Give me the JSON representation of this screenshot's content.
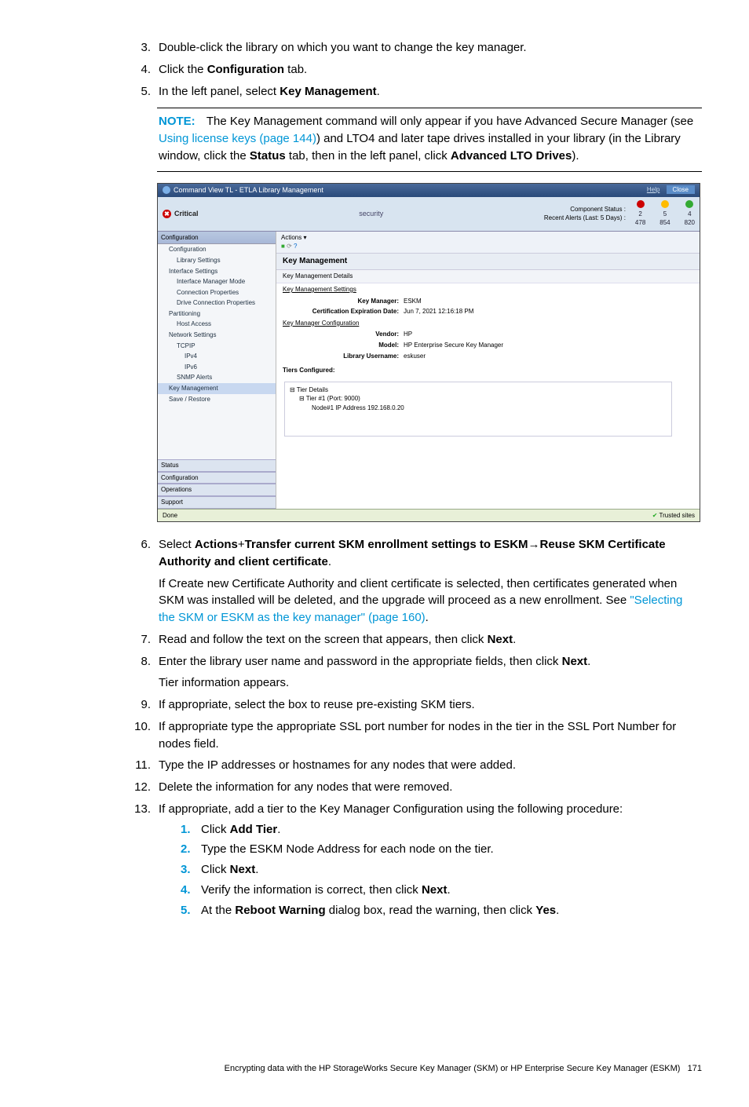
{
  "steps": {
    "s3": "Double-click the library on which you want to change the key manager.",
    "s4_a": "Click the ",
    "s4_b": "Configuration",
    "s4_c": " tab.",
    "s5_a": "In the left panel, select ",
    "s5_b": "Key Management",
    "s5_c": ".",
    "s6_a": "Select ",
    "s6_b": "Actions",
    "s6_c": "+",
    "s6_d": "Transfer current SKM enrollment settings to ESKM",
    "s6_e": "→",
    "s6_f": "Reuse SKM Certificate Authority and client certificate",
    "s6_g": ".",
    "s6_p1": "If Create new Certificate Authority and client certificate is selected, then certificates generated when SKM was installed will be deleted, and the upgrade will proceed as a new enrollment. See ",
    "s6_link": "\"Selecting the SKM or ESKM as the key manager\" (page 160)",
    "s6_p2": ".",
    "s7_a": "Read and follow the text on the screen that appears, then click ",
    "s7_b": "Next",
    "s7_c": ".",
    "s8_a": "Enter the library user name and password in the appropriate fields, then click ",
    "s8_b": "Next",
    "s8_c": ".",
    "s8_p": "Tier information appears.",
    "s9": "If appropriate, select the box to reuse pre-existing SKM tiers.",
    "s10": "If appropriate type the appropriate SSL port number for nodes in the tier in the SSL Port Number for nodes field.",
    "s11": "Type the IP addresses or hostnames for any nodes that were added.",
    "s12": "Delete the information for any nodes that were removed.",
    "s13": "If appropriate, add a tier to the Key Manager Configuration using the following procedure:",
    "s13_1a": "Click ",
    "s13_1b": "Add Tier",
    "s13_1c": ".",
    "s13_2": "Type the ESKM Node Address for each node on the tier.",
    "s13_3a": "Click ",
    "s13_3b": "Next",
    "s13_3c": ".",
    "s13_4a": "Verify the information is correct, then click ",
    "s13_4b": "Next",
    "s13_4c": ".",
    "s13_5a": "At the ",
    "s13_5b": "Reboot Warning",
    "s13_5c": " dialog box, read the warning, then click ",
    "s13_5d": "Yes",
    "s13_5e": "."
  },
  "note": {
    "label": "NOTE:",
    "t1": "The Key Management command will only appear if you have Advanced Secure Manager (see ",
    "link": "Using license keys (page 144)",
    "t2": ") and LTO4 and later tape drives installed in your library (in the Library window, click the ",
    "b1": "Status",
    "t3": " tab, then in the left panel, click ",
    "b2": "Advanced LTO Drives",
    "t4": ")."
  },
  "shot": {
    "title": "Command View TL - ETLA Library Management",
    "help": "Help",
    "close": "Close",
    "critical": "Critical",
    "security": "security",
    "comp_label": "Component Status :",
    "alerts_label": "Recent Alerts (Last: 5 Days) :",
    "v1": "2",
    "v2": "5",
    "v3": "4",
    "v4": "478",
    "v5": "854",
    "v6": "820",
    "side_config": "Configuration",
    "side_items": {
      "cfg": "Configuration",
      "lib": "Library Settings",
      "iface": "Interface Settings",
      "imm": "Interface Manager Mode",
      "conn": "Connection Properties",
      "drv": "Drive Connection Properties",
      "part": "Partitioning",
      "host": "Host Access",
      "net": "Network Settings",
      "tcp": "TCPIP",
      "ipv4": "IPv4",
      "ipv6": "IPv6",
      "snmp": "SNMP Alerts",
      "key": "Key Management",
      "save": "Save / Restore"
    },
    "side_bottom": {
      "status": "Status",
      "config": "Configuration",
      "ops": "Operations",
      "support": "Support"
    },
    "main": {
      "actions": "Actions ▾",
      "title": "Key Management",
      "kmd": "Key Management Details",
      "kms": "Key Management Settings",
      "km_label": "Key Manager:",
      "km_val": "ESKM",
      "ced_label": "Certification Expiration Date:",
      "ced_val": "Jun 7, 2021 12:16:18 PM",
      "kmc": "Key Manager Configuration",
      "vendor_l": "Vendor:",
      "vendor_v": "HP",
      "model_l": "Model:",
      "model_v": "HP Enterprise Secure Key Manager",
      "libu_l": "Library Username:",
      "libu_v": "eskuser",
      "tiers": "Tiers Configured:",
      "tierdet": "Tier Details",
      "tier1": "Tier #1 (Port: 9000)",
      "node1": "Node#1 IP Address 192.168.0.20"
    },
    "done": "Done",
    "trusted": "Trusted sites"
  },
  "footer": {
    "text": "Encrypting data with the HP StorageWorks Secure Key Manager (SKM) or HP Enterprise Secure Key Manager (ESKM)",
    "page": "171"
  }
}
